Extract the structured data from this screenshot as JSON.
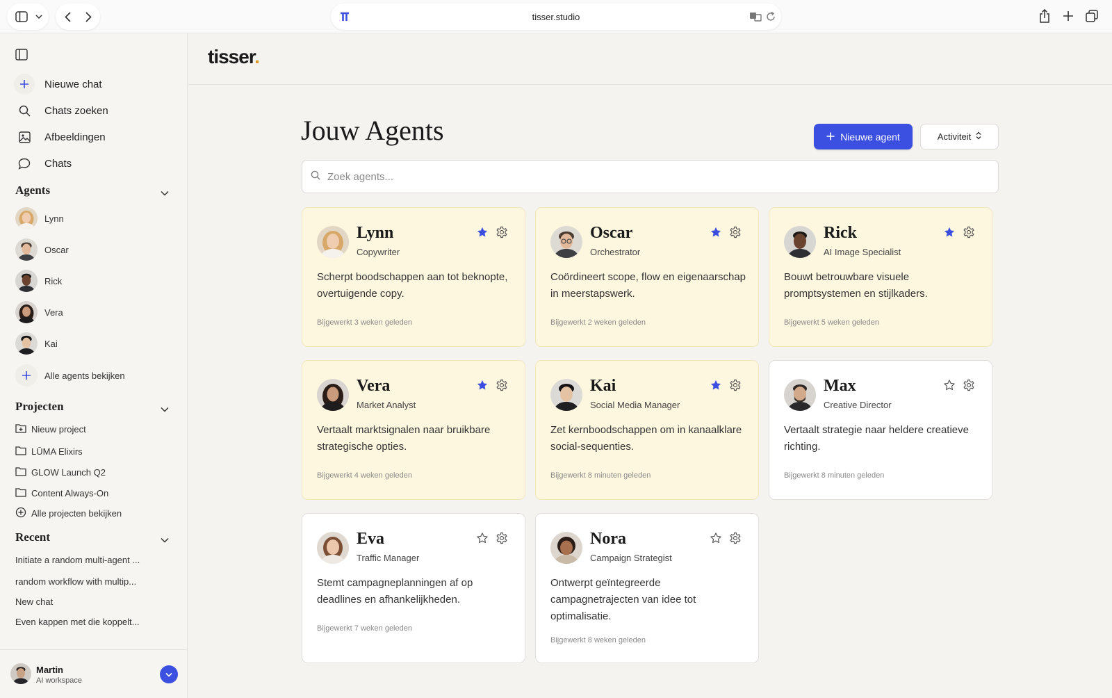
{
  "browser": {
    "url": "tisser.studio"
  },
  "brand": {
    "logo_text": "tisser",
    "logo_dot": ".",
    "accent": "#3b4fe0",
    "dot_color": "#d99a1e"
  },
  "sidebar": {
    "nav": [
      {
        "label": "Nieuwe chat",
        "icon": "plus-icon"
      },
      {
        "label": "Chats zoeken",
        "icon": "search-icon"
      },
      {
        "label": "Afbeeldingen",
        "icon": "image-icon"
      },
      {
        "label": "Chats",
        "icon": "chat-bubble-icon"
      }
    ],
    "agents_heading": "Agents",
    "agents": [
      "Lynn",
      "Oscar",
      "Rick",
      "Vera",
      "Kai"
    ],
    "all_agents": "Alle agents bekijken",
    "projects_heading": "Projecten",
    "projects": [
      "Nieuw project",
      "LŪMA Elixirs",
      "GLOW Launch Q2",
      "Content Always-On"
    ],
    "all_projects": "Alle projecten bekijken",
    "recent_heading": "Recent",
    "recent": [
      "Initiate a random multi-agent ...",
      "random workflow with multip...",
      "New chat",
      "Even kappen met die koppelt..."
    ],
    "user": {
      "name": "Martin",
      "workspace": "AI workspace"
    }
  },
  "main": {
    "title": "Jouw Agents",
    "new_agent_label": "Nieuwe agent",
    "sort_label": "Activiteit",
    "search_placeholder": "Zoek agents...",
    "agents": [
      {
        "name": "Lynn",
        "role": "Copywriter",
        "desc": "Scherpt boodschappen aan tot beknopte, overtuigende copy.",
        "updated": "Bijgewerkt 3 weken geleden",
        "favorite": true
      },
      {
        "name": "Oscar",
        "role": "Orchestrator",
        "desc": "Coördineert scope, flow en eigenaarschap in meerstapswerk.",
        "updated": "Bijgewerkt 2 weken geleden",
        "favorite": true
      },
      {
        "name": "Rick",
        "role": "AI Image Specialist",
        "desc": "Bouwt betrouwbare visuele promptsystemen en stijlkaders.",
        "updated": "Bijgewerkt 5 weken geleden",
        "favorite": true
      },
      {
        "name": "Vera",
        "role": "Market Analyst",
        "desc": "Vertaalt marktsignalen naar bruikbare strategische opties.",
        "updated": "Bijgewerkt 4 weken geleden",
        "favorite": true
      },
      {
        "name": "Kai",
        "role": "Social Media Manager",
        "desc": "Zet kernboodschappen om in kanaalklare social-sequenties.",
        "updated": "Bijgewerkt 8 minuten geleden",
        "favorite": true
      },
      {
        "name": "Max",
        "role": "Creative Director",
        "desc": "Vertaalt strategie naar heldere creatieve richting.",
        "updated": "Bijgewerkt 8 minuten geleden",
        "favorite": false
      },
      {
        "name": "Eva",
        "role": "Traffic Manager",
        "desc": "Stemt campagneplanningen af op deadlines en afhankelijkheden.",
        "updated": "Bijgewerkt 7 weken geleden",
        "favorite": false
      },
      {
        "name": "Nora",
        "role": "Campaign Strategist",
        "desc": "Ontwerpt geïntegreerde campagnetrajecten van idee tot optimalisatie.",
        "updated": "Bijgewerkt 8 weken geleden",
        "favorite": false
      }
    ]
  }
}
